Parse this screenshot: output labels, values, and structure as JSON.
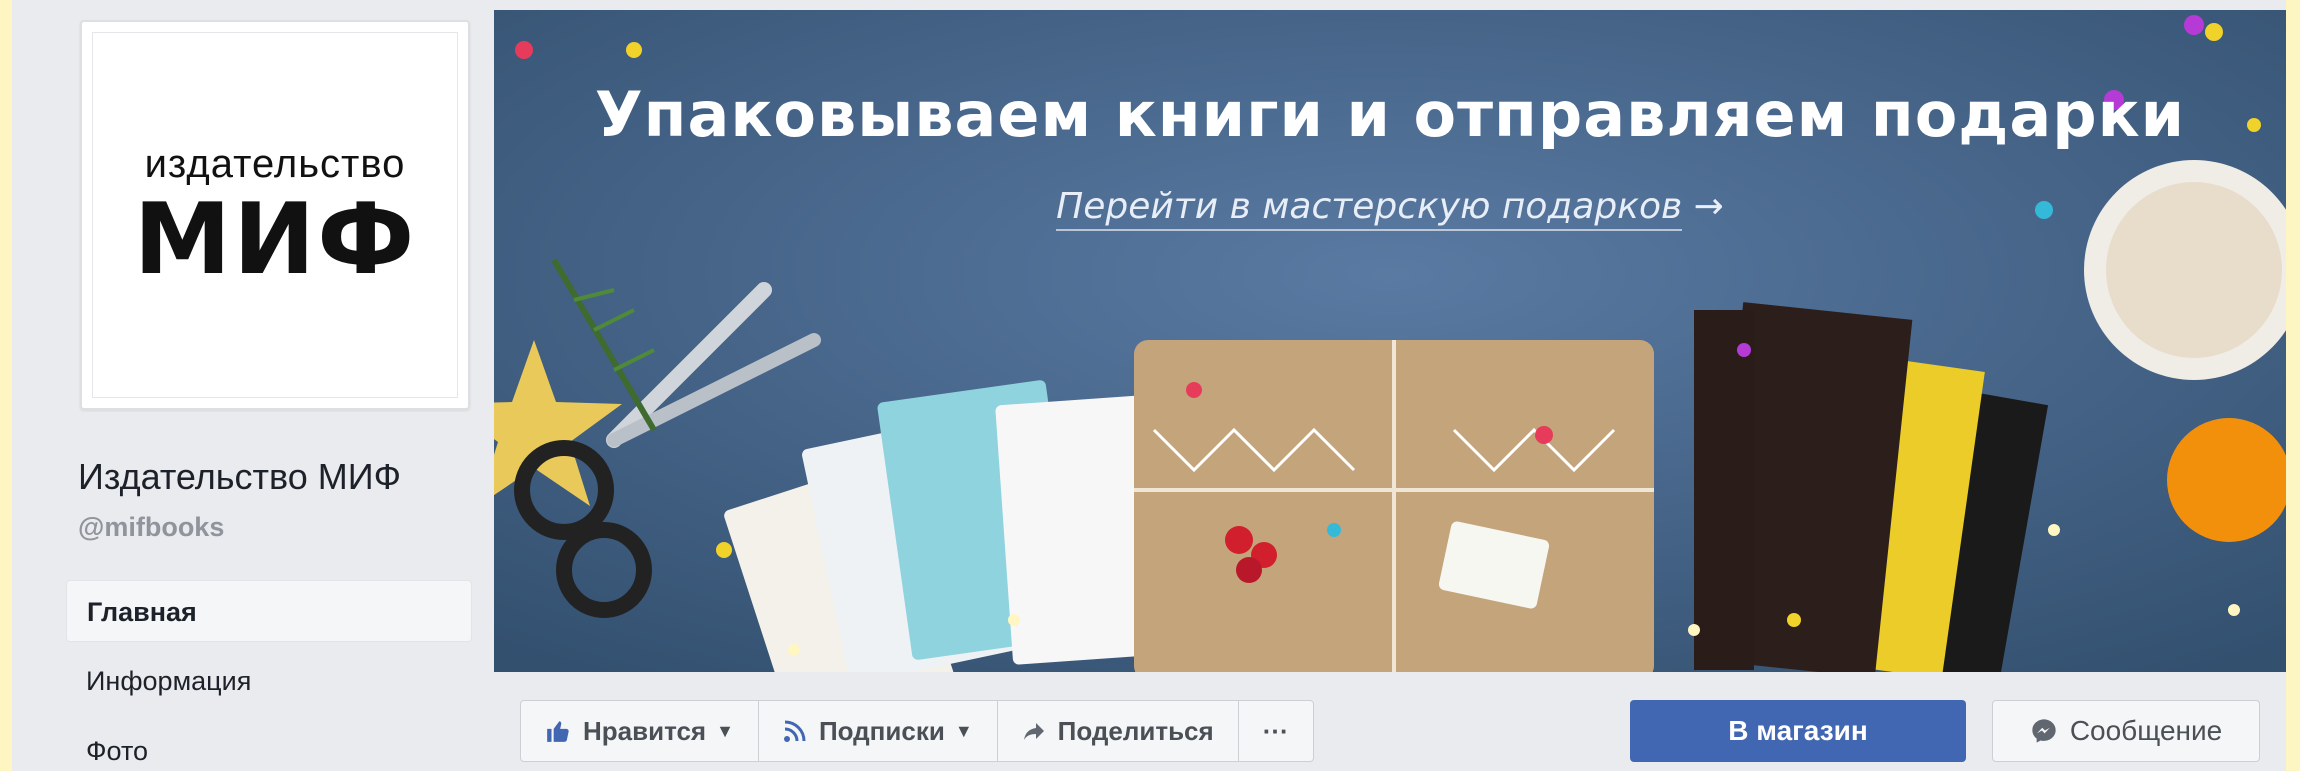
{
  "page": {
    "logo_line1": "издательство",
    "logo_line2": "МИФ",
    "name": "Издательство МИФ",
    "handle": "@mifbooks"
  },
  "nav": {
    "items": [
      {
        "label": "Главная",
        "active": true
      },
      {
        "label": "Информация",
        "active": false
      },
      {
        "label": "Фото",
        "active": false
      }
    ]
  },
  "cover": {
    "title": "Упаковываем книги и отправляем подарки",
    "link_text": "Перейти в мастерскую подарков",
    "link_arrow": "→"
  },
  "actions": {
    "like": {
      "label": "Нравится",
      "icon": "thumbs-up-icon"
    },
    "follow": {
      "label": "Подписки",
      "icon": "rss-icon"
    },
    "share": {
      "label": "Поделиться",
      "icon": "share-arrow-icon"
    },
    "more": {
      "label": "···",
      "icon": "more-dots-icon"
    },
    "shop": {
      "label": "В магазин"
    },
    "message": {
      "label": "Сообщение",
      "icon": "messenger-icon"
    }
  },
  "colors": {
    "brand_blue": "#4267b2",
    "page_bg": "#e9ebee",
    "cover_bg": "#3f5f86",
    "frame": "#fdf6c3"
  }
}
